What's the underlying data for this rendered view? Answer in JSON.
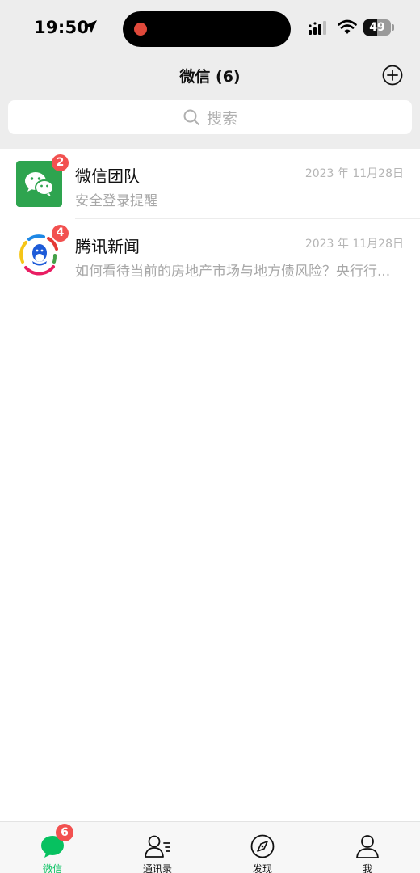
{
  "status_bar": {
    "time": "19:50",
    "battery_percent": "49",
    "battery_level": 0.49
  },
  "nav": {
    "title": "微信 (6)"
  },
  "search": {
    "placeholder": "搜索"
  },
  "chats": [
    {
      "name": "微信团队",
      "time": "2023 年 11月28日",
      "preview": "安全登录提醒",
      "badge": "2",
      "avatar_icon": "wechat-logo-icon"
    },
    {
      "name": "腾讯新闻",
      "time": "2023 年 11月28日",
      "preview": "如何看待当前的房地产市场与地方债风险？央行行...",
      "badge": "4",
      "avatar_icon": "tencent-news-logo-icon"
    }
  ],
  "tab_bar": {
    "tabs": [
      {
        "label": "微信",
        "icon": "chat-bubble-icon",
        "badge": "6",
        "active": true
      },
      {
        "label": "通讯录",
        "icon": "contacts-icon",
        "active": false
      },
      {
        "label": "发现",
        "icon": "compass-icon",
        "active": false
      },
      {
        "label": "我",
        "icon": "person-icon",
        "active": false
      }
    ]
  },
  "colors": {
    "accent_green": "#07c160",
    "badge_red": "#f25150",
    "header_bg": "#ededed"
  }
}
